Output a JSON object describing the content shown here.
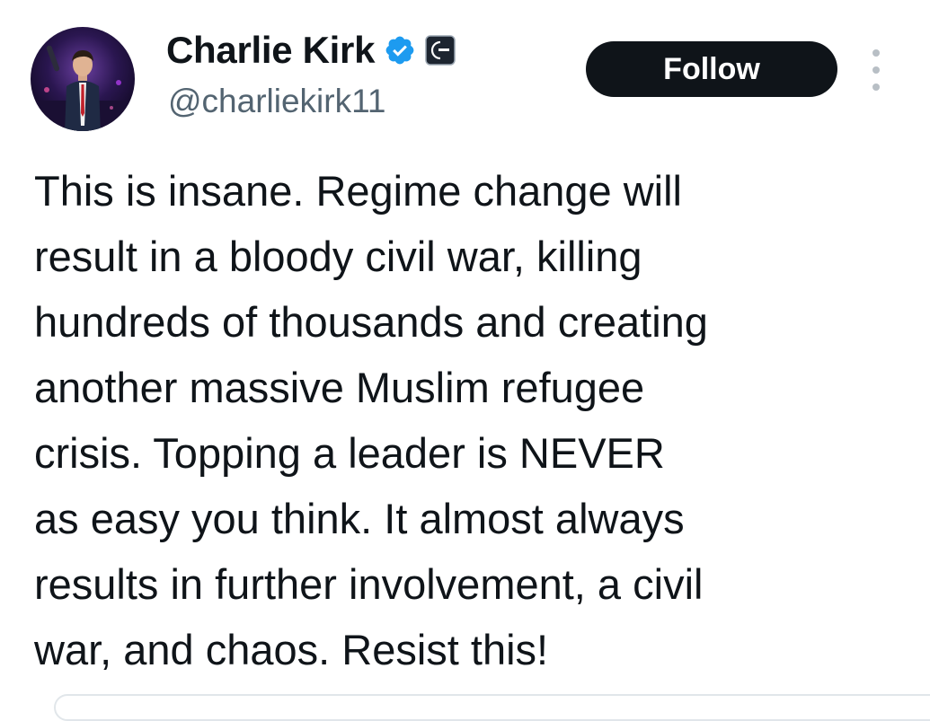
{
  "author": {
    "display_name": "Charlie Kirk",
    "handle": "@charliekirk11",
    "verified": true,
    "verified_icon": "verified-check-icon",
    "affiliate_icon": "affiliate-org-logo-icon",
    "avatar_icon": "profile-photo-avatar"
  },
  "actions": {
    "follow_label": "Follow",
    "more_icon": "more-options-icon"
  },
  "tweet": {
    "lines": [
      "This is insane. Regime change will",
      "result in a bloody civil war, killing",
      "hundreds of thousands and creating",
      "another massive Muslim refugee",
      "crisis. Topping a leader is NEVER",
      "as easy you think. It almost always",
      "results in further involvement, a civil",
      "war, and chaos. Resist this!"
    ]
  },
  "colors": {
    "text": "#0f1419",
    "secondary_text": "#536471",
    "verified_blue": "#1d9bf0",
    "follow_bg": "#0f1419",
    "follow_text": "#ffffff"
  }
}
